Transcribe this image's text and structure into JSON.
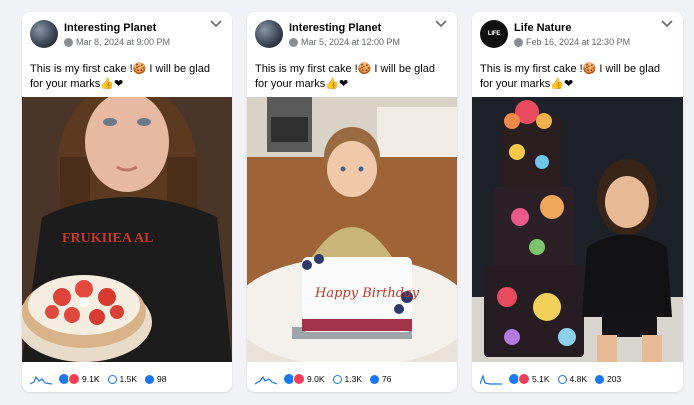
{
  "posts": [
    {
      "page_name": "Interesting Planet",
      "date": "Mar 8, 2024 at 9:00 PM",
      "text": "This is my first cake !🍪 I will be glad for your marks👍❤",
      "reactions": "9.1K",
      "comments": "1.5K",
      "shares": "98"
    },
    {
      "page_name": "Interesting Planet",
      "date": "Mar 5, 2024 at 12:00 PM",
      "text": "This is my first cake !🍪 I will be glad for your marks👍❤",
      "reactions": "9.0K",
      "comments": "1.3K",
      "shares": "76",
      "cake_text": "Happy Birthday"
    },
    {
      "page_name": "Life Nature",
      "avatar_text": "LIFE",
      "date": "Feb 16, 2024 at 12:30 PM",
      "text": "This is my first cake !🍪 I will be glad for your marks👍❤",
      "reactions": "5.1K",
      "comments": "4.8K",
      "shares": "203"
    }
  ]
}
